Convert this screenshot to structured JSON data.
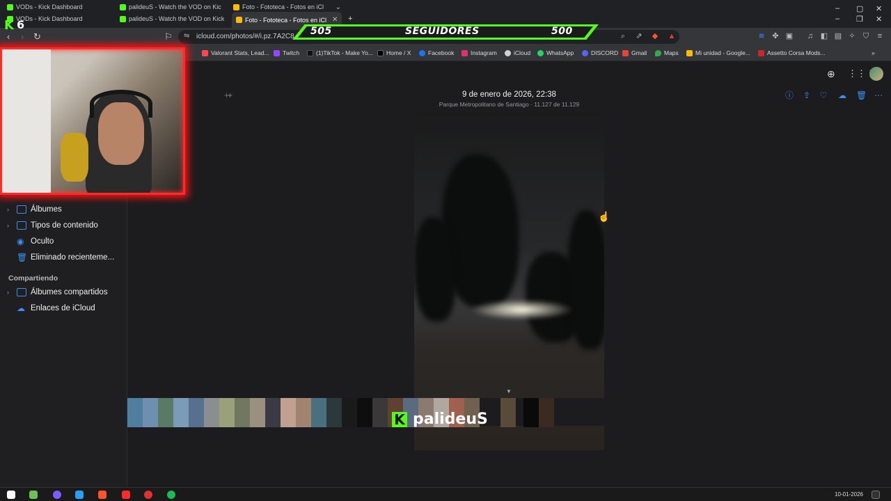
{
  "tabs": [
    {
      "label": "VODs - Kick Dashboard"
    },
    {
      "label": "palideuS - Watch the VOD on Kick"
    },
    {
      "label": "Foto - Fototeca - Fotos en iCl"
    }
  ],
  "tabs_back_row": [
    {
      "label": "VODs - Kick Dashboard"
    },
    {
      "label": "palideuS - Watch the VOD on Kic"
    },
    {
      "label": "Foto - Fototeca - Fotos en iCl"
    }
  ],
  "address": {
    "url": "icloud.com/photos/#/i.pz.7A2C8"
  },
  "bookmarks": [
    {
      "label": "Valorant Stats, Lead...",
      "color": "#ff4655"
    },
    {
      "label": "Twitch",
      "color": "#9146ff"
    },
    {
      "label": "(1)TikTok - Make Yo...",
      "color": "#111111"
    },
    {
      "label": "Home / X",
      "color": "#000000"
    },
    {
      "label": "Facebook",
      "color": "#1877f2"
    },
    {
      "label": "Instagram",
      "color": "#e1306c"
    },
    {
      "label": "iCloud",
      "color": "#d0d0d0"
    },
    {
      "label": "WhatsApp",
      "color": "#25d366"
    },
    {
      "label": "DISCORD",
      "color": "#5865f2"
    },
    {
      "label": "Gmail",
      "color": "#ea4335"
    },
    {
      "label": "Maps",
      "color": "#34a853"
    },
    {
      "label": "Mi unidad - Google...",
      "color": "#fbbc04"
    },
    {
      "label": "Assetto Corsa Mods...",
      "color": "#c62828"
    }
  ],
  "sidebar": {
    "items": [
      {
        "label": "Álbumes",
        "expandable": true
      },
      {
        "label": "Tipos de contenido",
        "expandable": true
      },
      {
        "label": "Oculto",
        "expandable": false
      },
      {
        "label": "Eliminado recienteme...",
        "expandable": false
      }
    ],
    "section_shared": "Compartiendo",
    "shared_items": [
      {
        "label": "Álbumes compartidos",
        "expandable": true
      },
      {
        "label": "Enlaces de iCloud",
        "expandable": false
      }
    ]
  },
  "viewer": {
    "date": "9 de enero de 2026, 22:38",
    "subtitle": "Parque Metropolitano de Santiago · 11.127 de 11.129"
  },
  "overlay": {
    "followers_left": "505",
    "followers_label": "SEGUIDORES",
    "followers_goal": "500",
    "kick_badge": "6",
    "watermark_name": "palideuS",
    "watermark_logo": "K"
  },
  "taskbar": {
    "date": "10-01-2026"
  },
  "colors": {
    "kick_green": "#53fc18",
    "icloud_blue": "#3b8ff0",
    "cam_border": "#ff2a2a"
  }
}
